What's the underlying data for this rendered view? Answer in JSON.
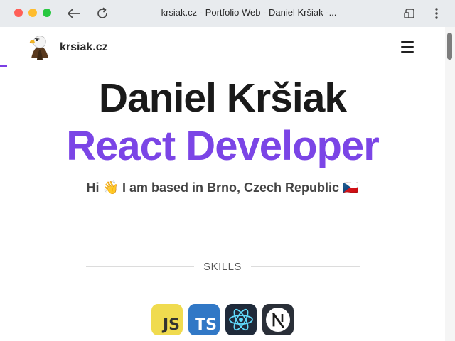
{
  "window": {
    "title": "krsiak.cz - Portfolio Web - Daniel Kršiak -..."
  },
  "navbar": {
    "site_name": "krsiak.cz"
  },
  "hero": {
    "name": "Daniel Kršiak",
    "role": "React Developer",
    "tagline": "Hi 👋 I am based in Brno, Czech Republic 🇨🇿"
  },
  "skills": {
    "heading": "SKILLS",
    "items": [
      {
        "label": "JS",
        "icon": "javascript-icon",
        "color": "#f0db4f"
      },
      {
        "label": "TS",
        "icon": "typescript-icon",
        "color": "#3178c6"
      },
      {
        "label": "",
        "icon": "react-icon",
        "color": "#61dafb"
      },
      {
        "label": "",
        "icon": "nextjs-icon",
        "color": "#ffffff"
      }
    ]
  },
  "colors": {
    "accent": "#7b45e6",
    "scroll_progress": "#7b3fe4"
  }
}
